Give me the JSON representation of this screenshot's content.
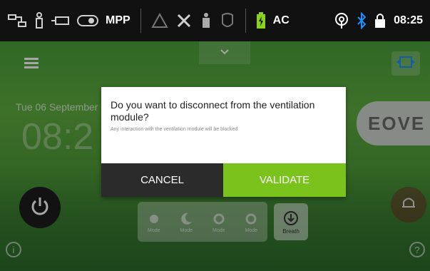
{
  "statusbar": {
    "mode_label": "MPP",
    "power_label": "AC",
    "clock": "08:25",
    "icons": [
      "network-icon",
      "person-icon",
      "plug-icon",
      "toggle-icon",
      "warning-icon",
      "tools-icon",
      "patient-icon",
      "mask-icon",
      "battery-icon",
      "wifi-icon",
      "bluetooth-icon",
      "lock-icon"
    ]
  },
  "background": {
    "date": "Tue 06 September",
    "time": "08:2",
    "logo": "EOVE"
  },
  "modes": {
    "items": [
      "Mode",
      "Mode",
      "Mode",
      "Mode"
    ],
    "breath_label": "Breath"
  },
  "dialog": {
    "title": "Do you want to disconnect from the ventilation module?",
    "message": "Any interaction with the ventilation module will be blocked",
    "cancel_label": "CANCEL",
    "validate_label": "VALIDATE"
  },
  "colors": {
    "validate": "#7ac31c",
    "cancel": "#2b2b2b",
    "bluetooth": "#1e90ff",
    "battery": "#8bd21c"
  }
}
